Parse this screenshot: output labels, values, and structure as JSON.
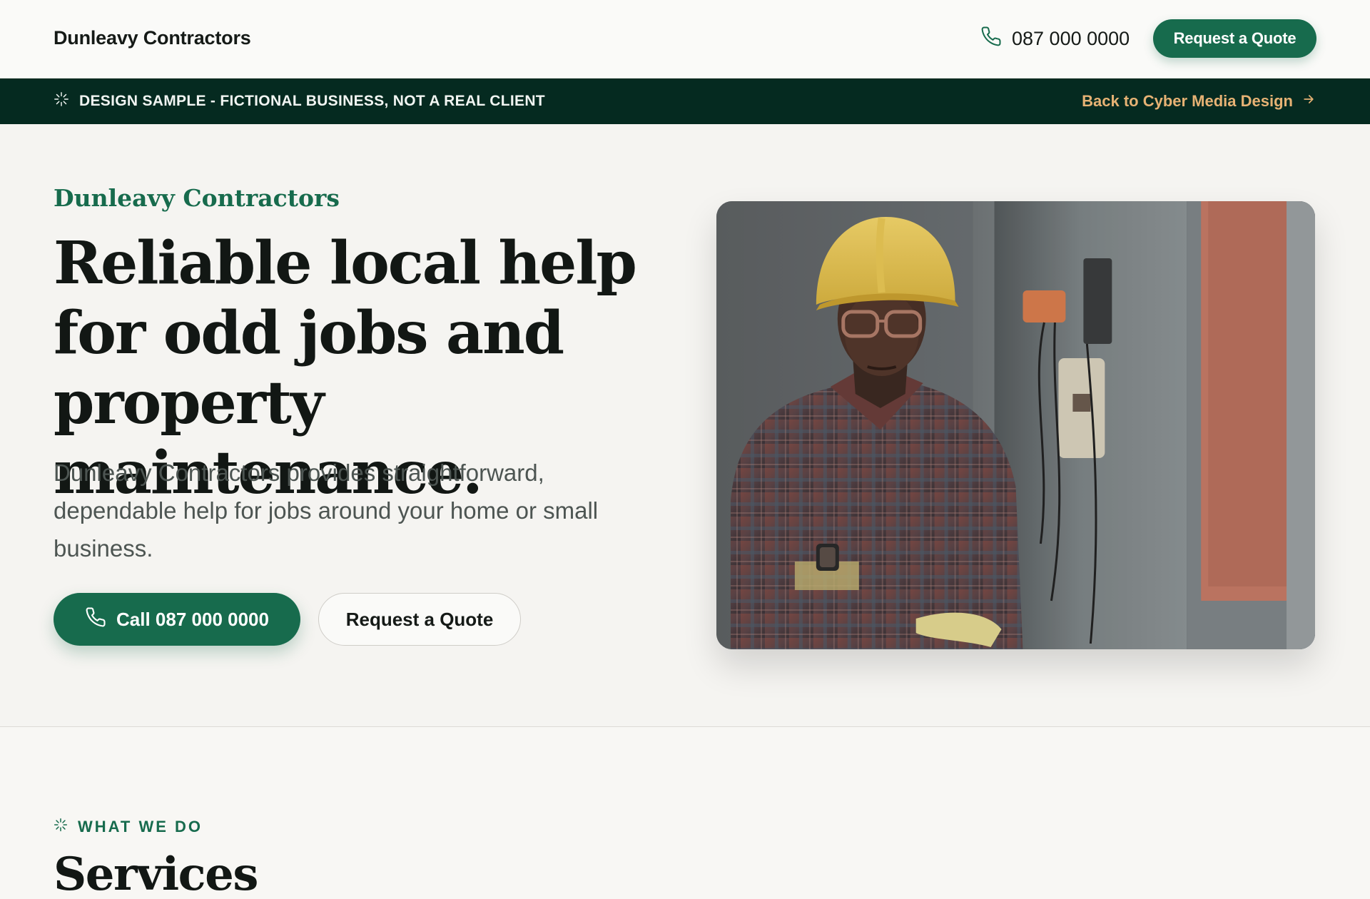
{
  "header": {
    "brand": "Dunleavy Contractors",
    "phone": "087 000 0000",
    "cta_label": "Request a Quote"
  },
  "banner": {
    "notice": "DESIGN SAMPLE - FICTIONAL BUSINESS, NOT A REAL CLIENT",
    "back_link": "Back to Cyber Media Design"
  },
  "hero": {
    "eyebrow": "Dunleavy Contractors",
    "title": "Reliable local help for odd jobs and property maintenance.",
    "description": "Dunleavy Contractors provides straightforward, dependable help for jobs around your home or small business.",
    "call_button": "Call 087 000 0000",
    "quote_button": "Request a Quote"
  },
  "services": {
    "eyebrow": "WHAT WE DO",
    "title": "Services"
  },
  "colors": {
    "brand_green": "#176b4d",
    "banner_bg": "#052a20",
    "banner_link": "#e6b274",
    "page_bg": "#f5f4f1"
  },
  "icons": {
    "phone": "phone-icon",
    "sparkle": "sparkle-icon",
    "arrow": "arrow-right-icon"
  }
}
